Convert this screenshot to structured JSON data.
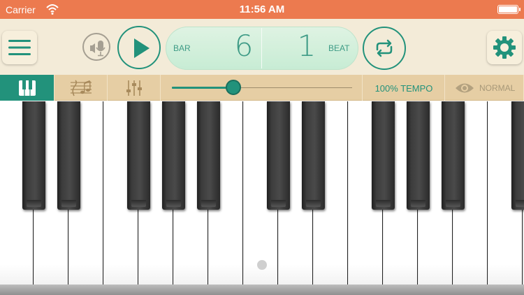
{
  "status_bar": {
    "carrier": "Carrier",
    "time": "11:56 AM",
    "wifi_icon": "wifi-icon",
    "battery_icon": "battery-icon"
  },
  "toolbar": {
    "menu_icon": "hamburger-menu-icon",
    "voice_icon": "voice-record-icon",
    "play_icon": "play-icon",
    "counter": {
      "bar_label": "BAR",
      "bar_value": "6",
      "beat_value": "1",
      "beat_label": "BEAT"
    },
    "loop_icon": "loop-icon",
    "settings_icon": "gear-icon"
  },
  "subbar": {
    "tabs": [
      {
        "name": "piano",
        "icon": "piano-keys-icon",
        "active": true
      },
      {
        "name": "score",
        "icon": "sheet-music-icon",
        "active": false
      },
      {
        "name": "mixer",
        "icon": "mixer-sliders-icon",
        "active": false
      }
    ],
    "slider_position": 0.34,
    "tempo_label": "100% TEMPO",
    "view_icon": "eye-icon",
    "view_mode": "NORMAL"
  },
  "keyboard": {
    "white_key_count": 15,
    "black_keys_after_white_index": [
      0,
      1,
      3,
      4,
      5,
      7,
      8,
      10,
      11,
      12,
      14
    ]
  },
  "colors": {
    "status_bar": "#ec7a4f",
    "accent": "#22927b",
    "toolbar_bg": "#f3ebd8",
    "subbar_bg": "#e6cea4",
    "counter_bg": "#c7ecd4"
  }
}
